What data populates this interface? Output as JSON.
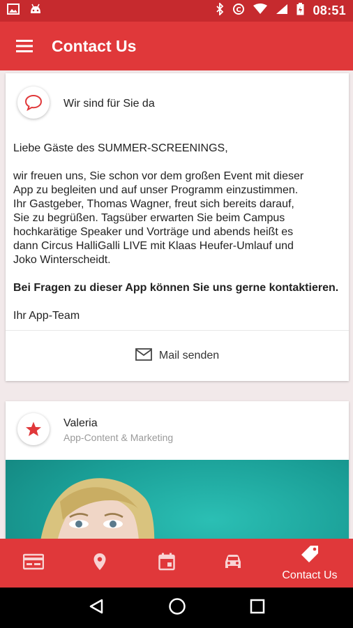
{
  "status_bar": {
    "time": "08:51",
    "icons_left": [
      "image-icon",
      "android-icon"
    ],
    "icons_right": [
      "bluetooth-icon",
      "data-saver-icon",
      "wifi-icon",
      "signal-icon",
      "battery-icon"
    ]
  },
  "app_bar": {
    "title": "Contact Us",
    "menu_icon": "hamburger-menu-icon"
  },
  "info_card": {
    "icon": "chat-bubble-icon",
    "title": "Wir sind für Sie da",
    "greeting": "Liebe Gäste des SUMMER-SCREENINGS,",
    "paragraph": "wir freuen uns, Sie schon vor dem großen Event mit dieser\nApp zu begleiten und auf unser Programm einzustimmen.\nIhr Gastgeber, Thomas Wagner, freut sich bereits darauf,\nSie zu begrüßen. Tagsüber erwarten Sie beim Campus\nhochkarätige Speaker und Vorträge und abends heißt es\ndann Circus HalliGalli LIVE mit Klaas Heufer-Umlauf und\nJoko Winterscheidt.",
    "bold_line": "Bei Fragen zu dieser App können Sie uns gerne kontaktieren.",
    "signature": "Ihr App-Team",
    "mail_icon": "envelope-icon",
    "mail_label": "Mail senden"
  },
  "person_card": {
    "icon": "star-icon",
    "name": "Valeria",
    "role": "App-Content & Marketing"
  },
  "bottom_nav": {
    "items": [
      {
        "icon": "ticket-card-icon",
        "label": ""
      },
      {
        "icon": "location-pin-icon",
        "label": ""
      },
      {
        "icon": "calendar-icon",
        "label": ""
      },
      {
        "icon": "car-icon",
        "label": ""
      },
      {
        "icon": "tag-icon",
        "label": "Contact Us"
      }
    ],
    "active_index": 4
  },
  "system_nav": [
    "back-icon",
    "home-icon",
    "recents-icon"
  ],
  "colors": {
    "primary": "#e0383a",
    "status_bar": "#c62a2e",
    "accent_icon": "#e0383a",
    "background": "#f2e9ea"
  }
}
